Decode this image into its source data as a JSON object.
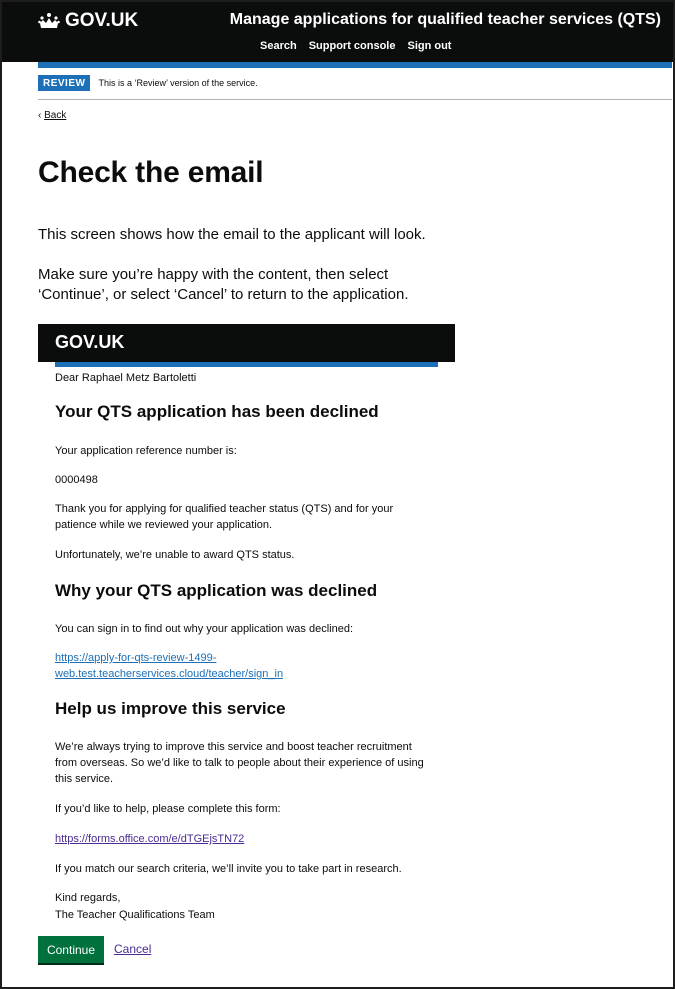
{
  "header": {
    "logo_text": "GOV.UK",
    "service_name": "Manage applications for qualified teacher services (QTS)",
    "nav": [
      "Search",
      "Support console",
      "Sign out"
    ]
  },
  "phase_banner": {
    "tag": "REVIEW",
    "text": "This is a ‘Review’ version of the service."
  },
  "back_link": "Back",
  "page": {
    "title": "Check the email",
    "intro": "This screen shows how the email to the applicant will look.",
    "instruction": "Make sure you’re happy with the content, then select ‘Continue’, or select ‘Cancel’ to return to the application."
  },
  "email": {
    "logo_text": "GOV.UK",
    "greeting": "Dear Raphael Metz Bartoletti",
    "heading_declined": "Your QTS application has been declined",
    "reference_label": "Your application reference number is:",
    "reference_number": "0000498",
    "thanks": "Thank you for applying for qualified teacher status (QTS) and for your patience while we reviewed your application.",
    "unable": "Unfortunately, we’re unable to award QTS status.",
    "heading_why": "Why your QTS application was declined",
    "sign_in_text": "You can sign in to find out why your application was declined:",
    "sign_in_link_line1": "https://apply-for-qts-review-1499-",
    "sign_in_link_line2": "web.test.teacherservices.cloud/teacher/sign_in",
    "heading_help": "Help us improve this service",
    "improve_text": "We’re always trying to improve this service and boost teacher recruitment from overseas. So we’d like to talk to people about their experience of using this service.",
    "form_intro": "If you’d like to help, please complete this form:",
    "form_link": "https://forms.office.com/e/dTGEjsTN72",
    "research_text": "If you match our search criteria, we’ll invite you to take part in research.",
    "signoff_1": "Kind regards,",
    "signoff_2": "The Teacher Qualifications Team"
  },
  "actions": {
    "continue": "Continue",
    "cancel": "Cancel"
  },
  "colors": {
    "header_bg": "#0b0c0c",
    "brand_blue": "#1d70b8",
    "button_green": "#00703c",
    "visited_link": "#4c2c92"
  }
}
